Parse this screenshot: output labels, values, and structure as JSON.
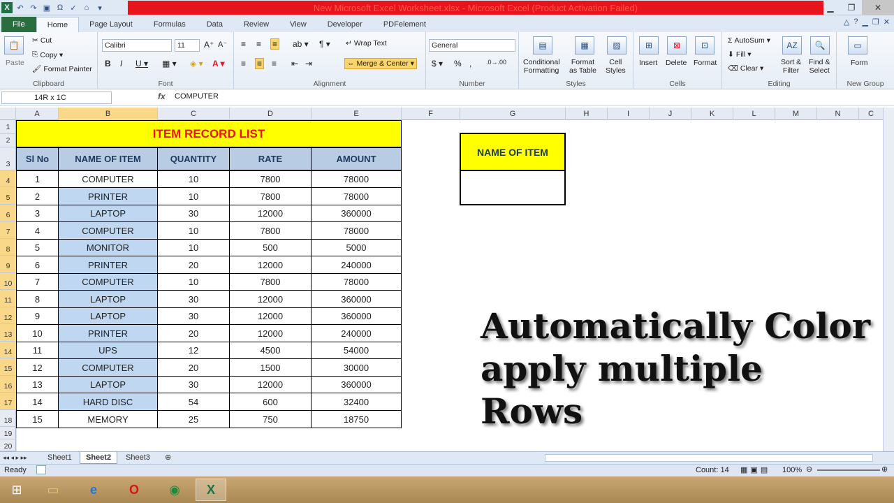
{
  "window": {
    "title": "New Microsoft Excel Worksheet.xlsx - Microsoft Excel (Product Activation Failed)"
  },
  "ribbon_tabs": [
    "File",
    "Home",
    "Page Layout",
    "Formulas",
    "Data",
    "Review",
    "View",
    "Developer",
    "PDFelement"
  ],
  "ribbon": {
    "clipboard": {
      "paste": "Paste",
      "cut": "Cut",
      "copy": "Copy",
      "format_painter": "Format Painter",
      "label": "Clipboard"
    },
    "font": {
      "name": "Calibri",
      "size": "11",
      "label": "Font"
    },
    "alignment": {
      "wrap": "Wrap Text",
      "merge": "Merge & Center",
      "label": "Alignment"
    },
    "number": {
      "format": "General",
      "label": "Number"
    },
    "styles": {
      "conditional": "Conditional",
      "conditional2": "Formatting",
      "format_table": "Format",
      "format_table2": "as Table",
      "cell_styles": "Cell",
      "cell_styles2": "Styles",
      "label": "Styles"
    },
    "cells": {
      "insert": "Insert",
      "delete": "Delete",
      "format": "Format",
      "label": "Cells"
    },
    "editing": {
      "autosum": "AutoSum",
      "fill": "Fill",
      "clear": "Clear",
      "sort": "Sort &",
      "sort2": "Filter",
      "find": "Find &",
      "find2": "Select",
      "label": "Editing"
    },
    "newgroup": {
      "form": "Form",
      "label": "New Group"
    }
  },
  "formula_bar": {
    "name_box": "14R x 1C",
    "fx": "fx",
    "content": "COMPUTER"
  },
  "columns": [
    "A",
    "B",
    "C",
    "D",
    "E",
    "F",
    "G",
    "H",
    "I",
    "J",
    "K",
    "L",
    "M",
    "N",
    "C"
  ],
  "rows": [
    "1",
    "2",
    "3",
    "4",
    "5",
    "6",
    "7",
    "8",
    "9",
    "10",
    "11",
    "12",
    "13",
    "14",
    "15",
    "16",
    "17",
    "18",
    "19",
    "20"
  ],
  "table": {
    "title": "ITEM RECORD LIST",
    "headers": [
      "Sl No",
      "NAME OF ITEM",
      "QUANTITY",
      "RATE",
      "AMOUNT"
    ],
    "rows": [
      [
        "1",
        "COMPUTER",
        "10",
        "7800",
        "78000"
      ],
      [
        "2",
        "PRINTER",
        "10",
        "7800",
        "78000"
      ],
      [
        "3",
        "LAPTOP",
        "30",
        "12000",
        "360000"
      ],
      [
        "4",
        "COMPUTER",
        "10",
        "7800",
        "78000"
      ],
      [
        "5",
        "MONITOR",
        "10",
        "500",
        "5000"
      ],
      [
        "6",
        "PRINTER",
        "20",
        "12000",
        "240000"
      ],
      [
        "7",
        "COMPUTER",
        "10",
        "7800",
        "78000"
      ],
      [
        "8",
        "LAPTOP",
        "30",
        "12000",
        "360000"
      ],
      [
        "9",
        "LAPTOP",
        "30",
        "12000",
        "360000"
      ],
      [
        "10",
        "PRINTER",
        "20",
        "12000",
        "240000"
      ],
      [
        "11",
        "UPS",
        "12",
        "4500",
        "54000"
      ],
      [
        "12",
        "COMPUTER",
        "20",
        "1500",
        "30000"
      ],
      [
        "13",
        "LAPTOP",
        "30",
        "12000",
        "360000"
      ],
      [
        "14",
        "HARD DISC",
        "54",
        "600",
        "32400"
      ],
      [
        "15",
        "MEMORY",
        "25",
        "750",
        "18750"
      ]
    ]
  },
  "side_box": {
    "header": "NAME OF ITEM",
    "value": ""
  },
  "overlay_text": {
    "line1": "Automatically Color",
    "line2": "apply multiple Rows"
  },
  "sheets": [
    "Sheet1",
    "Sheet2",
    "Sheet3"
  ],
  "status": {
    "ready": "Ready",
    "count": "Count: 14",
    "zoom": "100%"
  },
  "colors": {
    "title_bg": "#ffff00",
    "title_fg": "#e8141b",
    "header_bg": "#b8cce4",
    "selected_bg": "#bfd7f0",
    "file_tab": "#2a6e3f"
  }
}
